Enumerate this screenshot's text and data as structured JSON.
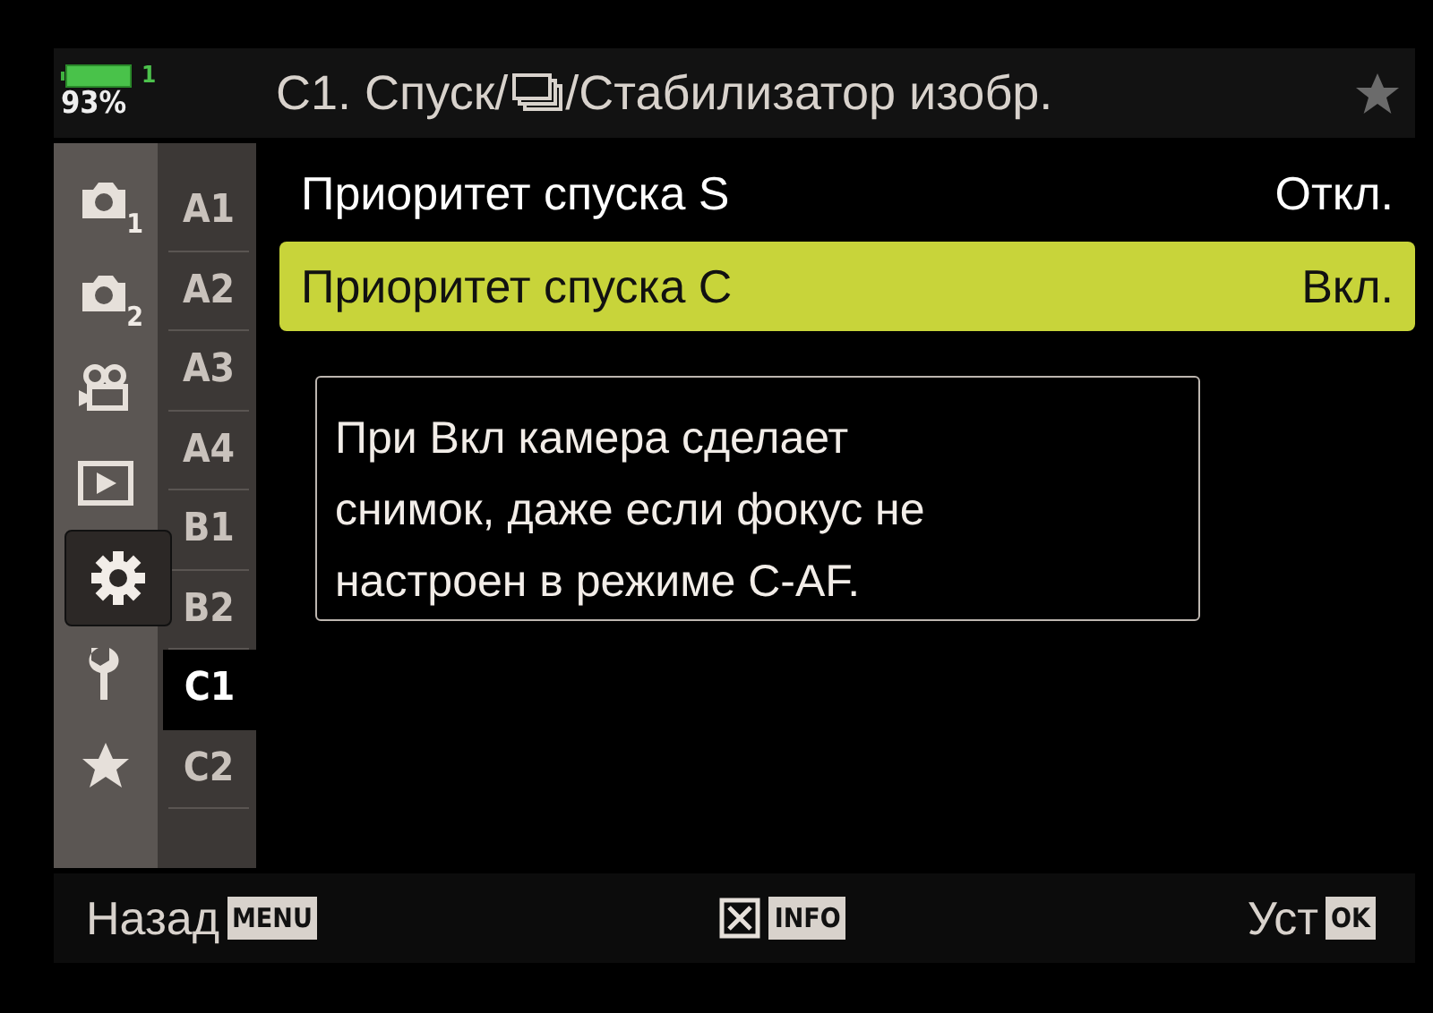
{
  "status": {
    "battery_level_text": "93%",
    "card_slot": "1"
  },
  "header": {
    "title_parts": [
      "C1. Спуск/",
      "/Стабилизатор изобр."
    ]
  },
  "tabs": [
    {
      "kind": "camera",
      "badge": "1",
      "selected": false
    },
    {
      "kind": "camera",
      "badge": "2",
      "selected": false
    },
    {
      "kind": "movie",
      "selected": false
    },
    {
      "kind": "playback",
      "selected": false
    },
    {
      "kind": "gear",
      "selected": true
    },
    {
      "kind": "wrench",
      "selected": false
    },
    {
      "kind": "star",
      "selected": false
    }
  ],
  "subtabs": [
    {
      "label": "A1",
      "selected": false
    },
    {
      "label": "A2",
      "selected": false
    },
    {
      "label": "A3",
      "selected": false
    },
    {
      "label": "A4",
      "selected": false
    },
    {
      "label": "B1",
      "selected": false
    },
    {
      "label": "B2",
      "selected": false
    },
    {
      "label": "C1",
      "selected": true
    },
    {
      "label": "C2",
      "selected": false
    }
  ],
  "items": [
    {
      "label": "Приоритет спуска S",
      "value": "Откл.",
      "selected": false
    },
    {
      "label": "Приоритет спуска C",
      "value": "Вкл.",
      "selected": true
    }
  ],
  "tooltip": {
    "text": "При Вкл камера сделает снимок, даже если фокус не настроен в режиме C-AF."
  },
  "footer": [
    {
      "kind": "text_key",
      "label": "Назад",
      "key": "MENU"
    },
    {
      "kind": "icon_key",
      "key": "INFO"
    },
    {
      "kind": "text_key",
      "label": "Уст",
      "key": "OK"
    }
  ]
}
